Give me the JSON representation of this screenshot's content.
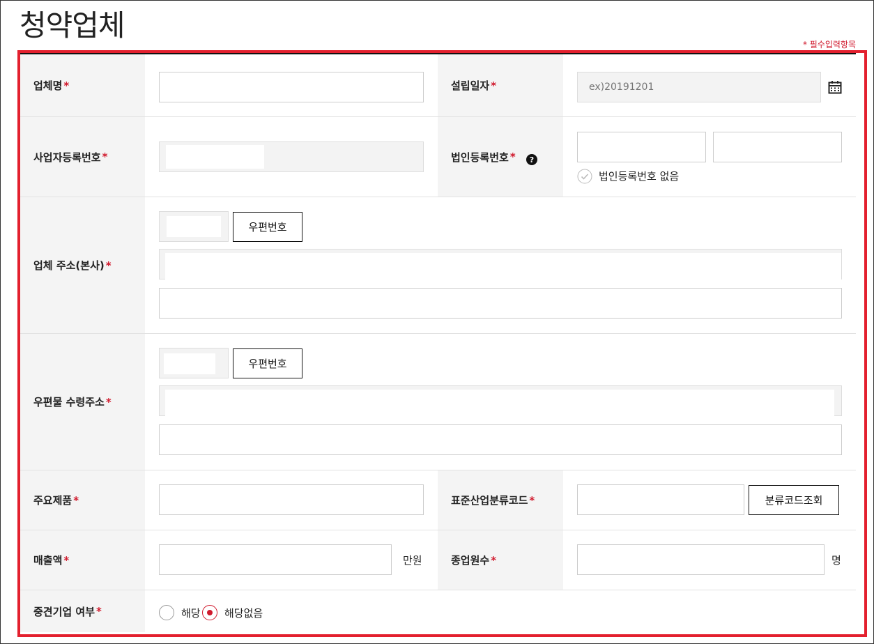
{
  "page": {
    "title": "청약업체",
    "required_note": "* 필수입력항목",
    "required_mark": "*"
  },
  "fields": {
    "company_name": {
      "label": "업체명"
    },
    "founding_date": {
      "label": "설립일자",
      "placeholder": "ex)20191201"
    },
    "business_reg_no": {
      "label": "사업자등록번호"
    },
    "corp_reg_no": {
      "label": "법인등록번호",
      "help": "?",
      "none_label": "법인등록번호 없음"
    },
    "hq_address": {
      "label": "업체 주소(본사)",
      "postcode_button": "우편번호"
    },
    "mail_address": {
      "label": "우편물 수령주소",
      "postcode_button": "우편번호"
    },
    "main_products": {
      "label": "주요제품"
    },
    "industry_code": {
      "label": "표준산업분류코드",
      "lookup_button": "분류코드조회"
    },
    "revenue": {
      "label": "매출액",
      "unit": "만원"
    },
    "employees": {
      "label": "종업원수",
      "unit": "명"
    },
    "midsize_company": {
      "label": "중견기업 여부",
      "options": [
        "해당",
        "해당없음"
      ],
      "selected": "해당없음"
    }
  },
  "colors": {
    "accent": "#e3202e",
    "required": "#d0192c",
    "header_bg": "#f4f4f4"
  }
}
